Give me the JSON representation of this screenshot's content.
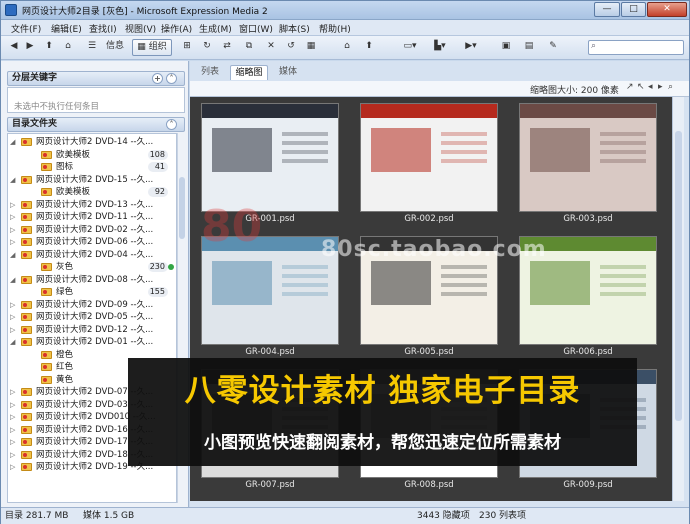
{
  "window": {
    "title": "网页设计大师2目录 [灰色] - Microsoft Expression Media 2",
    "minimize": "—",
    "maximize": "□",
    "close": "✕"
  },
  "menu": [
    "文件(F)",
    "编辑(E)",
    "查找(I)",
    "视图(V)",
    "操作(A)",
    "生成(M)",
    "窗口(W)",
    "脚本(S)",
    "帮助(H)"
  ],
  "toolbar": {
    "info_label": "信息",
    "organize_label": "组织",
    "search_placeholder": ""
  },
  "left_panel": {
    "keywords_title": "分层关键字",
    "keywords_hint": "未选中不执行任何条目",
    "catalog_title": "目录文件夹",
    "tree": [
      {
        "level": 1,
        "expanded": true,
        "label": "网页设计大师2 DVD-14 --久..."
      },
      {
        "level": 2,
        "label": "欧美模板",
        "count": "108"
      },
      {
        "level": 2,
        "label": "图标",
        "count": "41"
      },
      {
        "level": 1,
        "expanded": true,
        "label": "网页设计大师2 DVD-15 --久..."
      },
      {
        "level": 2,
        "label": "欧美模板",
        "count": "92"
      },
      {
        "level": 1,
        "expanded": false,
        "label": "网页设计大师2 DVD-13 --久..."
      },
      {
        "level": 1,
        "expanded": false,
        "label": "网页设计大师2 DVD-11 --久..."
      },
      {
        "level": 1,
        "expanded": false,
        "label": "网页设计大师2 DVD-02 --久..."
      },
      {
        "level": 1,
        "expanded": false,
        "label": "网页设计大师2 DVD-06 --久..."
      },
      {
        "level": 1,
        "expanded": true,
        "label": "网页设计大师2 DVD-04 --久..."
      },
      {
        "level": 2,
        "label": "灰色",
        "count": "230",
        "active": true
      },
      {
        "level": 1,
        "expanded": true,
        "label": "网页设计大师2 DVD-08 --久..."
      },
      {
        "level": 2,
        "label": "绿色",
        "count": "155"
      },
      {
        "level": 1,
        "expanded": false,
        "label": "网页设计大师2 DVD-09 --久..."
      },
      {
        "level": 1,
        "expanded": false,
        "label": "网页设计大师2 DVD-05 --久..."
      },
      {
        "level": 1,
        "expanded": false,
        "label": "网页设计大师2 DVD-12 --久..."
      },
      {
        "level": 1,
        "expanded": true,
        "label": "网页设计大师2 DVD-01 --久..."
      },
      {
        "level": 2,
        "label": "橙色"
      },
      {
        "level": 2,
        "label": "红色"
      },
      {
        "level": 2,
        "label": "黄色"
      },
      {
        "level": 1,
        "expanded": false,
        "label": "网页设计大师2 DVD-07 --久..."
      },
      {
        "level": 1,
        "expanded": false,
        "label": "网页设计大师2 DVD-03 --久..."
      },
      {
        "level": 1,
        "expanded": false,
        "label": "网页设计大师2 DVD010 --久..."
      },
      {
        "level": 1,
        "expanded": false,
        "label": "网页设计大师2 DVD-16 --久..."
      },
      {
        "level": 1,
        "expanded": false,
        "label": "网页设计大师2 DVD-17 --久..."
      },
      {
        "level": 1,
        "expanded": false,
        "label": "网页设计大师2 DVD-18 --久..."
      },
      {
        "level": 1,
        "expanded": false,
        "label": "网页设计大师2 DVD-19 --久..."
      }
    ]
  },
  "main": {
    "tabs": [
      {
        "label": "列表",
        "active": false
      },
      {
        "label": "缩略图",
        "active": true
      },
      {
        "label": "媒体",
        "active": false
      }
    ],
    "thumb_size_label": "缩略图大小: 200 像素",
    "thumbnails": [
      {
        "caption": "GR-001.psd",
        "scheme": "#e9eef3",
        "accent": "#2a2f3a"
      },
      {
        "caption": "GR-002.psd",
        "scheme": "#f2f2f2",
        "accent": "#b52a1e"
      },
      {
        "caption": "GR-003.psd",
        "scheme": "#d9c9c4",
        "accent": "#6b4a45"
      },
      {
        "caption": "GR-004.psd",
        "scheme": "#dfe5eb",
        "accent": "#5b8fb0"
      },
      {
        "caption": "GR-005.psd",
        "scheme": "#f3efe6",
        "accent": "#333333"
      },
      {
        "caption": "GR-006.psd",
        "scheme": "#eef3e2",
        "accent": "#5e8a31"
      },
      {
        "caption": "GR-007.psd",
        "scheme": "#dcdcdc",
        "accent": "#444444"
      },
      {
        "caption": "GR-008.psd",
        "scheme": "#ffffff",
        "accent": "#8a8a8a"
      },
      {
        "caption": "GR-009.psd",
        "scheme": "#cfd9e4",
        "accent": "#3b4f66"
      }
    ]
  },
  "status": {
    "catalog": "目录 281.7 MB",
    "media": "媒体 1.5 GB",
    "hidden": "3443 隐藏项",
    "listed": "230 列表项"
  },
  "overlay": {
    "headline": "八零设计素材  独家电子目录",
    "subline": "小图预览快速翻阅素材，帮您迅速定位所需素材",
    "watermark_url": "80sc.taobao.com",
    "watermark_mark": "80"
  }
}
